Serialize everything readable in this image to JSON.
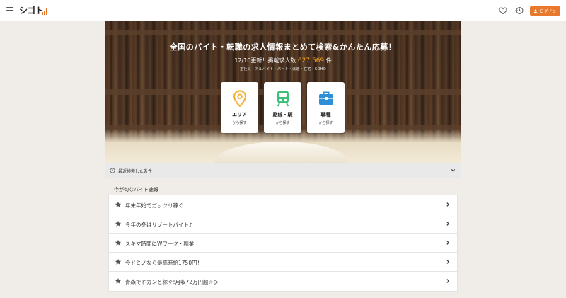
{
  "header": {
    "logo_text": "シゴト",
    "login_label": "ログイン",
    "icons": [
      "menu-icon",
      "heart-icon",
      "history-icon",
      "user-icon"
    ],
    "accent_color": "#e8782b"
  },
  "hero": {
    "title": "全国のバイト・転職の求人情報まとめて検索&かんたん応募！",
    "updated_prefix": "12/10更新！掲載求人数",
    "job_count": "627,569",
    "count_unit": "件",
    "categories": "正社員・アルバイト・パート・派遣・在宅・SOHO",
    "count_color": "#f5a623",
    "search_cards": [
      {
        "title": "エリア",
        "sub": "から探す",
        "icon": "map-pin-icon",
        "icon_color": "#f5b33a"
      },
      {
        "title": "路線・駅",
        "sub": "から探す",
        "icon": "train-icon",
        "icon_color": "#3dbf7a"
      },
      {
        "title": "職種",
        "sub": "から探す",
        "icon": "briefcase-icon",
        "icon_color": "#2f8fd6"
      }
    ]
  },
  "recent_search": {
    "label": "最近検索した条件"
  },
  "news": {
    "title": "今が旬なバイト速報",
    "items": [
      {
        "label": "年末年始でガッツリ稼ぐ！"
      },
      {
        "label": "今年の冬はリゾートバイト♪"
      },
      {
        "label": "スキマ時間にWワーク・副業"
      },
      {
        "label": "今ドミノなら最高時給1750円！"
      },
      {
        "label": "青森でドカンと稼ぐ!月収72万円超☆彡"
      }
    ]
  }
}
